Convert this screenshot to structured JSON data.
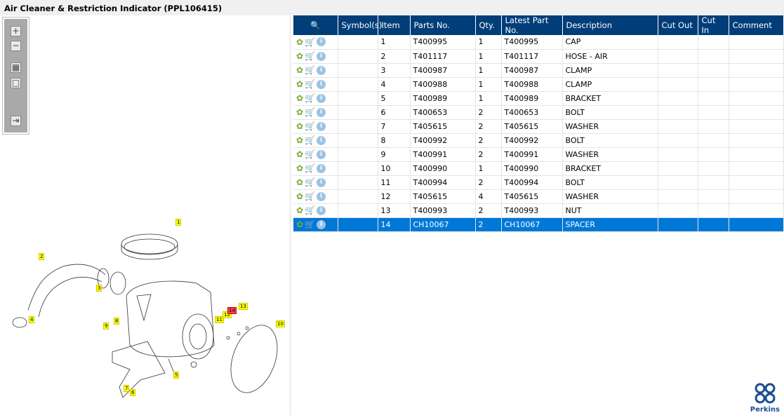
{
  "title": "Air Cleaner & Restriction Indicator (PPL106415)",
  "toolbar": {
    "zoom_in": "+",
    "zoom_out": "−",
    "fit": "▦",
    "actual": "□",
    "export": "⇥"
  },
  "callouts": [
    "1",
    "2",
    "3",
    "4",
    "5",
    "6",
    "7",
    "8",
    "9",
    "10",
    "11",
    "12",
    "13",
    "14"
  ],
  "selected_callout": "14",
  "table": {
    "headers": [
      "Symbol(s)",
      "Item",
      "Parts No.",
      "Qty.",
      "Latest Part No.",
      "Description",
      "Cut Out",
      "Cut In",
      "Comment"
    ],
    "rows": [
      {
        "item": "1",
        "part": "T400995",
        "qty": "1",
        "latest": "T400995",
        "desc": "CAP"
      },
      {
        "item": "2",
        "part": "T401117",
        "qty": "1",
        "latest": "T401117",
        "desc": "HOSE - AIR"
      },
      {
        "item": "3",
        "part": "T400987",
        "qty": "1",
        "latest": "T400987",
        "desc": "CLAMP"
      },
      {
        "item": "4",
        "part": "T400988",
        "qty": "1",
        "latest": "T400988",
        "desc": "CLAMP"
      },
      {
        "item": "5",
        "part": "T400989",
        "qty": "1",
        "latest": "T400989",
        "desc": "BRACKET"
      },
      {
        "item": "6",
        "part": "T400653",
        "qty": "2",
        "latest": "T400653",
        "desc": "BOLT"
      },
      {
        "item": "7",
        "part": "T405615",
        "qty": "2",
        "latest": "T405615",
        "desc": "WASHER"
      },
      {
        "item": "8",
        "part": "T400992",
        "qty": "2",
        "latest": "T400992",
        "desc": "BOLT"
      },
      {
        "item": "9",
        "part": "T400991",
        "qty": "2",
        "latest": "T400991",
        "desc": "WASHER"
      },
      {
        "item": "10",
        "part": "T400990",
        "qty": "1",
        "latest": "T400990",
        "desc": "BRACKET"
      },
      {
        "item": "11",
        "part": "T400994",
        "qty": "2",
        "latest": "T400994",
        "desc": "BOLT"
      },
      {
        "item": "12",
        "part": "T405615",
        "qty": "4",
        "latest": "T405615",
        "desc": "WASHER"
      },
      {
        "item": "13",
        "part": "T400993",
        "qty": "2",
        "latest": "T400993",
        "desc": "NUT"
      },
      {
        "item": "14",
        "part": "CH10067",
        "qty": "2",
        "latest": "CH10067",
        "desc": "SPACER"
      }
    ],
    "selected_item": "14"
  },
  "logo": "Perkins"
}
